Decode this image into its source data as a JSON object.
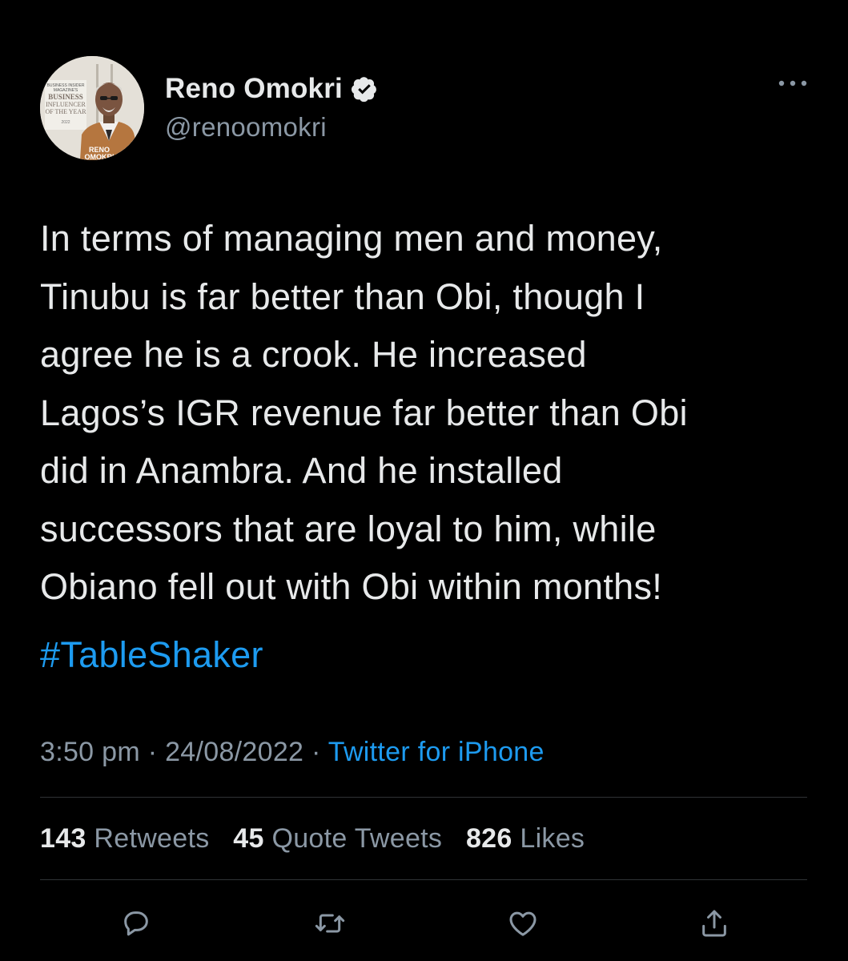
{
  "author": {
    "display_name": "Reno Omokri",
    "handle": "@renoomokri",
    "avatar_overlay_text": [
      "BUSINESS INSIDER",
      "MAGAZINE'S",
      "BUSINESS",
      "INFLUENCER",
      "OF THE YEAR",
      "2022",
      "RENO",
      "OMOKRI"
    ]
  },
  "tweet": {
    "text_lines": [
      "In terms of managing men and money,",
      "Tinubu is far better than Obi, though I",
      "agree he is a crook. He increased",
      "Lagos’s IGR revenue far better than Obi",
      "did in Anambra. And he installed",
      "successors that are loyal to him, while",
      "Obiano fell out with Obi within months!"
    ],
    "hashtag": "#TableShaker",
    "time": "3:50 pm",
    "separator": "·",
    "date": "24/08/2022",
    "source": "Twitter for iPhone"
  },
  "stats": {
    "retweets_count": "143",
    "retweets_label": "Retweets",
    "quote_count": "45",
    "quote_label": "Quote Tweets",
    "likes_count": "826",
    "likes_label": "Likes"
  },
  "colors": {
    "background": "#000000",
    "text": "#e7e9ea",
    "muted": "#8b98a5",
    "accent": "#1d9bf0",
    "divider": "#2f3336"
  },
  "icons": {
    "verified": "verified-badge-icon",
    "more": "more-options-icon",
    "reply": "reply-icon",
    "retweet": "retweet-icon",
    "like": "like-icon",
    "share": "share-icon"
  }
}
